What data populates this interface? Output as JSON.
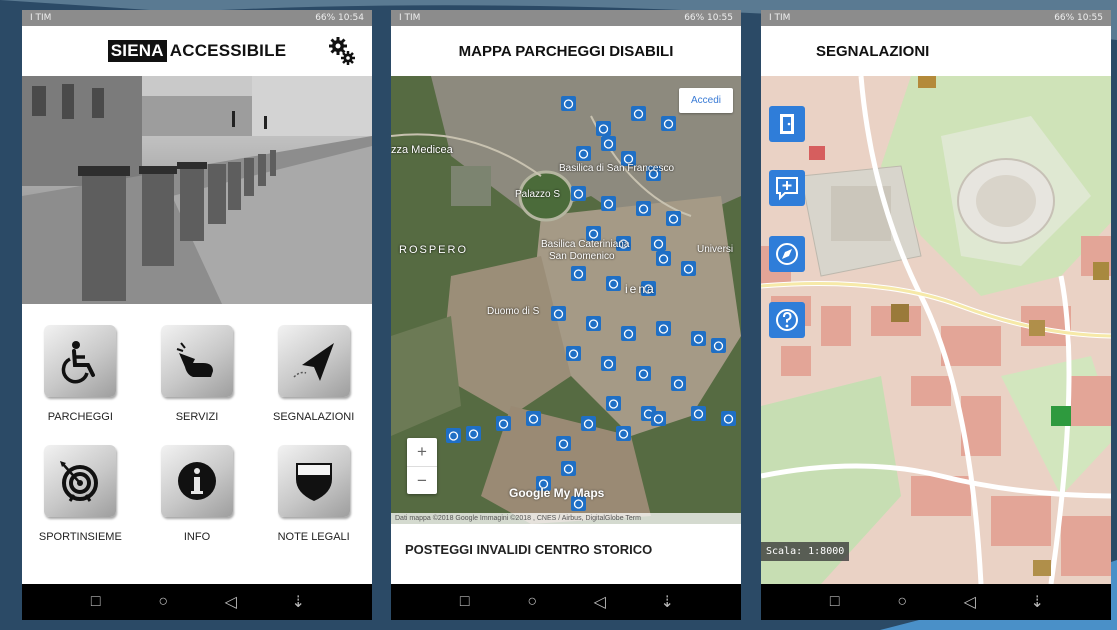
{
  "screens": {
    "home": {
      "status": {
        "left": "I TIM",
        "right": "66% 10:54"
      },
      "logo": {
        "boxed": "SIENA",
        "plain": "ACCESSIBILE"
      },
      "tiles": [
        {
          "label": "PARCHEGGI",
          "icon": "wheelchair-icon"
        },
        {
          "label": "SERVIZI",
          "icon": "hand-pointer-icon"
        },
        {
          "label": "SEGNALAZIONI",
          "icon": "paper-plane-icon"
        },
        {
          "label": "SPORTINSIEME",
          "icon": "target-icon"
        },
        {
          "label": "INFO",
          "icon": "info-icon"
        },
        {
          "label": "NOTE LEGALI",
          "icon": "shield-icon"
        }
      ]
    },
    "parking_map": {
      "status": {
        "left": "I TIM",
        "right": "66% 10:55"
      },
      "title": "MAPPA PARCHEGGI DISABILI",
      "login_button": "Accedi",
      "zoom_in": "+",
      "zoom_out": "−",
      "map_labels": {
        "medicea": "zza Medicea",
        "sanfrancesco": "Basilica di San Francesco",
        "palazzo": "Palazzo S",
        "rospero": "ROSPERO",
        "cateriniana": "Basilica Cateriniana",
        "domenico": "San Domenico",
        "siena": "iena",
        "duomo": "Duomo di S",
        "universita": "Universi"
      },
      "branding": "Google My Maps",
      "attribution": "Dati mappa ©2018 Google Immagini ©2018 , CNES / Airbus, DigitalGlobe   Term",
      "footer_title": "POSTEGGI INVALIDI CENTRO STORICO"
    },
    "reports": {
      "status": {
        "left": "I TIM",
        "right": "66% 10:55"
      },
      "title": "SEGNALAZIONI",
      "side_buttons": [
        "door-icon",
        "add-comment-icon",
        "compass-icon",
        "help-icon"
      ],
      "scale_label": "Scala: 1:8000"
    }
  },
  "nav_icons": [
    "square-icon",
    "circle-icon",
    "back-triangle-icon",
    "notification-icon"
  ],
  "colors": {
    "pin_blue": "#1f6fc5",
    "button_blue": "#2f7dd9",
    "road_pink": "#e9a59b",
    "park_green": "#cfe3b8"
  }
}
